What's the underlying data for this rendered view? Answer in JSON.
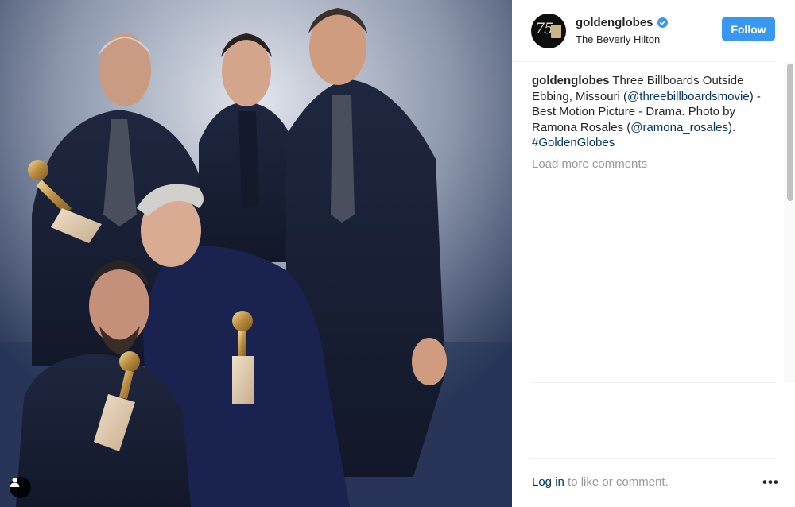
{
  "post": {
    "account": {
      "handle": "goldenglobes",
      "verified": true,
      "location": "The Beverly Hilton",
      "avatar_mark": "75"
    },
    "follow_label": "Follow",
    "caption": {
      "author": "goldenglobes",
      "text_1": " Three Billboards Outside Ebbing, Missouri (",
      "mention_1": "@threebillboardsmovie",
      "text_2": ") - Best Motion Picture - Drama. Photo by Ramona Rosales (",
      "mention_2": "@ramona_rosales",
      "text_3": "). ",
      "hashtag": "#GoldenGlobes"
    },
    "load_more_label": "Load more comments",
    "footer": {
      "login_link": "Log in",
      "login_text": " to like or comment.",
      "more_label": "•••"
    }
  },
  "photo": {
    "subject": "group-photo",
    "icons": [
      "user-tag-icon",
      "verified-badge-icon",
      "golden-globe-trophy-icon"
    ]
  },
  "colors": {
    "accent": "#3897f0",
    "link": "#003569",
    "muted": "#999999",
    "text": "#262626",
    "divider": "#efefef"
  }
}
